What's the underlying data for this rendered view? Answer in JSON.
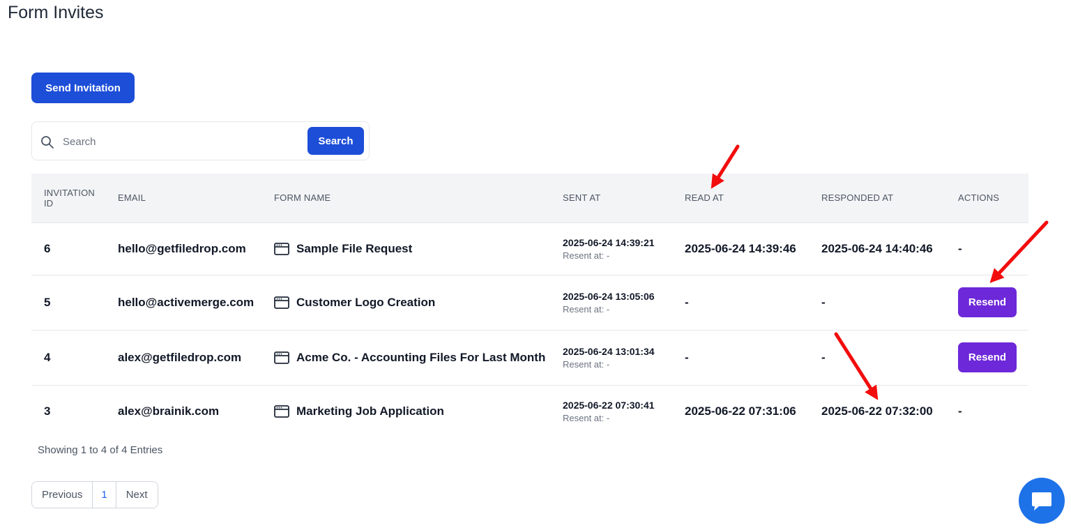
{
  "page": {
    "title": "Form Invites"
  },
  "toolbar": {
    "send_invitation_label": "Send Invitation"
  },
  "search": {
    "placeholder": "Search",
    "button_label": "Search"
  },
  "table": {
    "headers": [
      "INVITATION ID",
      "EMAIL",
      "FORM NAME",
      "SENT AT",
      "READ AT",
      "RESPONDED AT",
      "ACTIONS"
    ],
    "rows": [
      {
        "id": "6",
        "email": "hello@getfiledrop.com",
        "form_name": "Sample File Request",
        "sent_at": "2025-06-24 14:39:21",
        "resent_at": "Resent at: -",
        "read_at": "2025-06-24 14:39:46",
        "responded_at": "2025-06-24 14:40:46",
        "action": "-"
      },
      {
        "id": "5",
        "email": "hello@activemerge.com",
        "form_name": "Customer Logo Creation",
        "sent_at": "2025-06-24 13:05:06",
        "resent_at": "Resent at: -",
        "read_at": "-",
        "responded_at": "-",
        "action": "Resend"
      },
      {
        "id": "4",
        "email": "alex@getfiledrop.com",
        "form_name": "Acme Co. - Accounting Files For Last Month",
        "sent_at": "2025-06-24 13:01:34",
        "resent_at": "Resent at: -",
        "read_at": "-",
        "responded_at": "-",
        "action": "Resend"
      },
      {
        "id": "3",
        "email": "alex@brainik.com",
        "form_name": "Marketing Job Application",
        "sent_at": "2025-06-22 07:30:41",
        "resent_at": "Resent at: -",
        "read_at": "2025-06-22 07:31:06",
        "responded_at": "2025-06-22 07:32:00",
        "action": "-"
      }
    ]
  },
  "footer": {
    "entries_text": "Showing 1 to 4 of 4 Entries"
  },
  "pagination": {
    "previous": "Previous",
    "current": "1",
    "next": "Next"
  },
  "icons": {
    "search": "search-icon",
    "form": "browser-window-icon",
    "chat": "chat-bubble-icon",
    "annotation": "red-arrow-icon"
  },
  "colors": {
    "primary": "#1d4ed8",
    "resend": "#6d28d9",
    "chat": "#1d72e8",
    "annotation": "#f20d0d"
  }
}
